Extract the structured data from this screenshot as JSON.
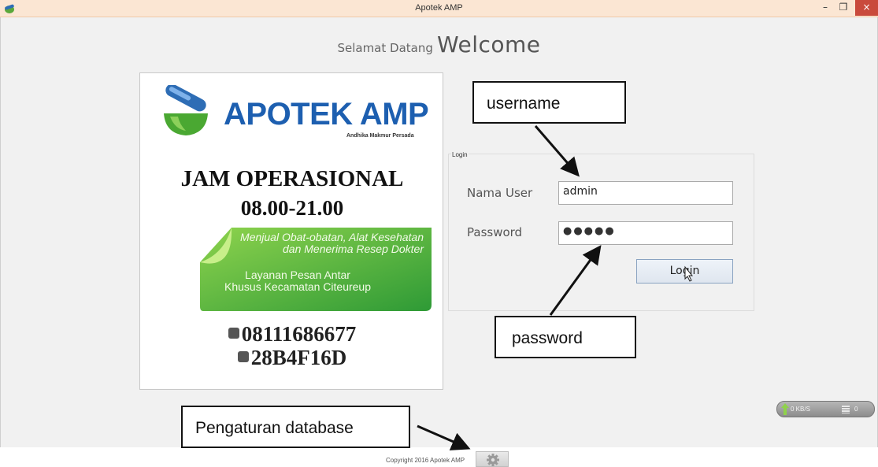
{
  "window": {
    "title": "Apotek AMP",
    "controls": {
      "minimize": "–",
      "maximize": "❐",
      "close": "×"
    }
  },
  "heading": {
    "small": "Selamat Datang",
    "big": "Welcome"
  },
  "poster": {
    "brand": "APOTEK",
    "brand_accent": "AMP",
    "brand_sub": "Andhika Makmur Persada",
    "hours_title": "JAM OPERASIONAL",
    "hours_time": "08.00-21.00",
    "banner_line1": "Menjual Obat-obatan, Alat Kesehatan",
    "banner_line2": "dan Menerima Resep Dokter",
    "banner_line3": "Layanan Pesan Antar",
    "banner_line4": "Khusus Kecamatan Citeureup",
    "phone": "08111686677",
    "pin": "28B4F16D",
    "colors": {
      "brand_blue": "#1d5fb0",
      "leaf_green": "#4aa832",
      "banner_green": "#3fa93a"
    }
  },
  "login": {
    "legend": "Login",
    "user_label": "Nama User",
    "user_value": "admin",
    "pass_label": "Password",
    "pass_value": "●●●●●",
    "button_label": "Login"
  },
  "callouts": {
    "username": "username",
    "password": "password",
    "database": "Pengaturan database"
  },
  "status": {
    "speed": "0 KB/S",
    "count": "0"
  },
  "footer": {
    "copyright": "Copyright 2016 Apotek AMP",
    "settings_icon": "gear-icon"
  }
}
